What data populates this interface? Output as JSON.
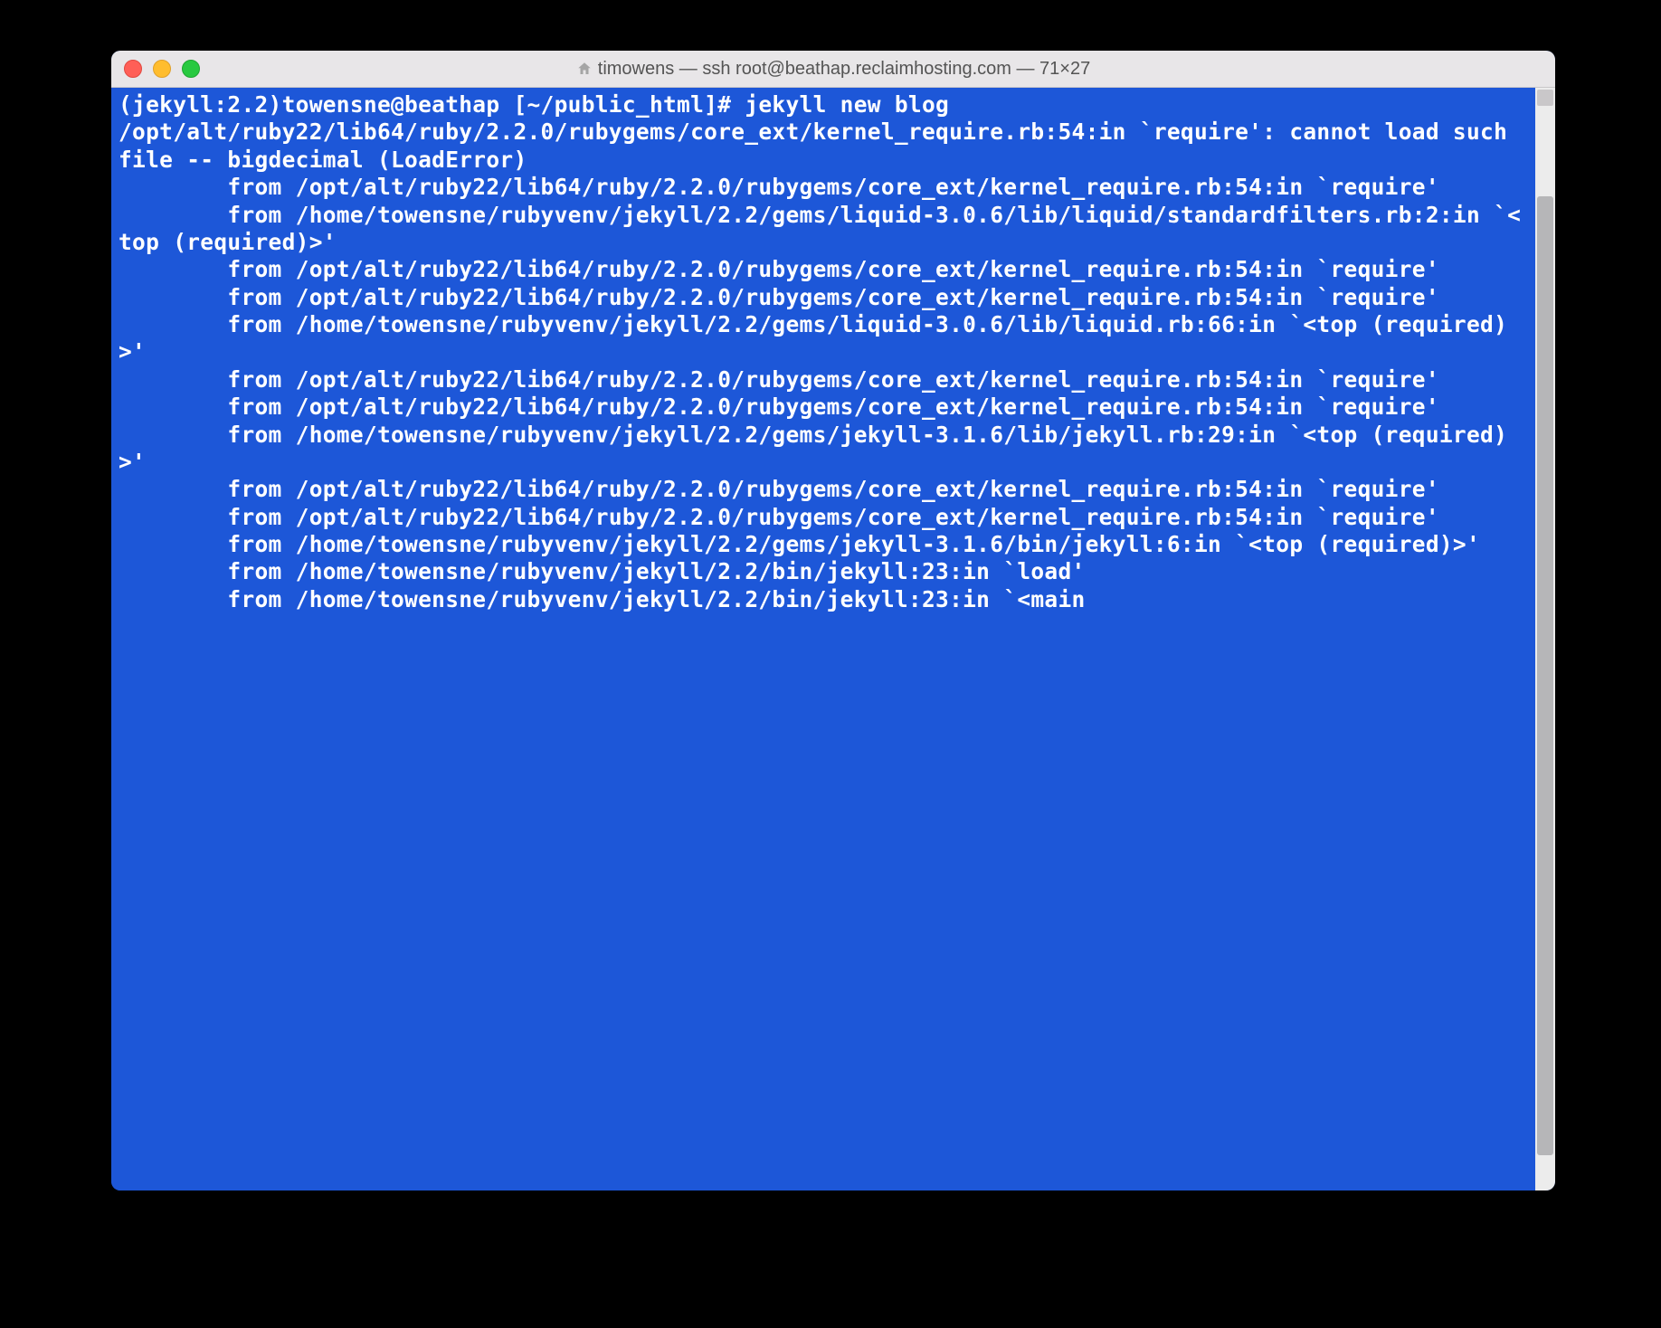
{
  "window": {
    "title": "timowens — ssh root@beathap.reclaimhosting.com — 71×27"
  },
  "terminal": {
    "prompt": "(jekyll:2.2)towensne@beathap [~/public_html]# ",
    "command": "jekyll new blog",
    "output": "/opt/alt/ruby22/lib64/ruby/2.2.0/rubygems/core_ext/kernel_require.rb:54:in `require': cannot load such file -- bigdecimal (LoadError)\n        from /opt/alt/ruby22/lib64/ruby/2.2.0/rubygems/core_ext/kernel_require.rb:54:in `require'\n        from /home/towensne/rubyvenv/jekyll/2.2/gems/liquid-3.0.6/lib/liquid/standardfilters.rb:2:in `<top (required)>'\n        from /opt/alt/ruby22/lib64/ruby/2.2.0/rubygems/core_ext/kernel_require.rb:54:in `require'\n        from /opt/alt/ruby22/lib64/ruby/2.2.0/rubygems/core_ext/kernel_require.rb:54:in `require'\n        from /home/towensne/rubyvenv/jekyll/2.2/gems/liquid-3.0.6/lib/liquid.rb:66:in `<top (required)>'\n        from /opt/alt/ruby22/lib64/ruby/2.2.0/rubygems/core_ext/kernel_require.rb:54:in `require'\n        from /opt/alt/ruby22/lib64/ruby/2.2.0/rubygems/core_ext/kernel_require.rb:54:in `require'\n        from /home/towensne/rubyvenv/jekyll/2.2/gems/jekyll-3.1.6/lib/jekyll.rb:29:in `<top (required)>'\n        from /opt/alt/ruby22/lib64/ruby/2.2.0/rubygems/core_ext/kernel_require.rb:54:in `require'\n        from /opt/alt/ruby22/lib64/ruby/2.2.0/rubygems/core_ext/kernel_require.rb:54:in `require'\n        from /home/towensne/rubyvenv/jekyll/2.2/gems/jekyll-3.1.6/bin/jekyll:6:in `<top (required)>'\n        from /home/towensne/rubyvenv/jekyll/2.2/bin/jekyll:23:in `load'\n        from /home/towensne/rubyvenv/jekyll/2.2/bin/jekyll:23:in `<main"
  }
}
